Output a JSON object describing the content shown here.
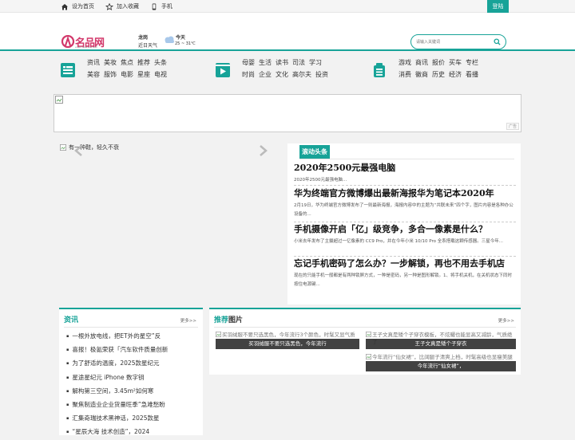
{
  "topbar": {
    "links": [
      {
        "label": "设为首页",
        "icon": "home-icon"
      },
      {
        "label": "加入收藏",
        "icon": "star-icon"
      },
      {
        "label": "手机",
        "icon": "mobile-icon"
      }
    ],
    "register": "注册",
    "login": "登陆"
  },
  "header": {
    "logo_text": "名品网",
    "logo_sub": "www.mpwang.com",
    "city": "龙岗",
    "city_sub": "近日天气",
    "weather_today": "今天",
    "weather_temp": "25 ~ 31℃",
    "search_placeholder": "请输入关键词"
  },
  "nav": {
    "groups": [
      {
        "icon": "list-icon",
        "row1": [
          "资讯",
          "美妆",
          "焦点",
          "推荐",
          "头条"
        ],
        "row2": [
          "美容",
          "服饰",
          "电影",
          "星座",
          "电视"
        ]
      },
      {
        "icon": "video-icon",
        "row1": [
          "母婴",
          "生活",
          "读书",
          "司法",
          "学习"
        ],
        "row2": [
          "时尚",
          "企业",
          "文化",
          "高尔夫",
          "投资"
        ]
      },
      {
        "icon": "files-icon",
        "row1": [
          "游戏",
          "商讯",
          "报价",
          "买车",
          "专栏"
        ],
        "row2": [
          "消费",
          "徽商",
          "历史",
          "经济",
          "看播"
        ]
      }
    ]
  },
  "banner": {
    "ad_label": "广告"
  },
  "slider": {
    "caption": "有一种鞋，轻久不衰"
  },
  "news": {
    "header": "滚动头条",
    "items": [
      {
        "title": "2020年2500元最强电脑",
        "desc": "2020年2500元最强电脑..."
      },
      {
        "title": "华为终端官方微博爆出最新海报华为笔记本2020年",
        "desc": "2月19日，华为终端官方微博发布了一则最新海报，海报内容中的主题为“共联未来”四个字，图片内容是各种办公设备的..."
      },
      {
        "title": "手机摄像开启「亿」级竞争，多合一像素是什么？",
        "desc": "小米去年发布了主摄超过一亿像素的 CC9 Pro，并在今年小米 10/10 Pro 全系搭载这颗传感器。三星今年..."
      },
      {
        "title": "忘记手机密码了怎么办？一步解锁，再也不用去手机店",
        "desc": "现在的只能手机一般都是有两种锁屏方式，一种是密码，另一种是图形解锁。1、将手机关机，在关机状态下同时按住电源键..."
      }
    ]
  },
  "zixun": {
    "title": "资讯",
    "more": "更多>>",
    "items": [
      "一根外放电线，把ET外的星空”反",
      "喜报！极氪荣获「汽车软件质量创新",
      "为了舒适的温度，2025款星纪元",
      "星途星纪元 iPhone 数字钥",
      "解构第三空间，3.45m²如何寒",
      "聚焦制造业企业货量旺季”急难愁盼",
      "汇集奇瑞技术黑神话，2025款星",
      "“星辰大海 技术创造”，2024"
    ]
  },
  "tuijian": {
    "title_a": "推荐",
    "title_b": "图片",
    "more": "更多>>",
    "pics": [
      {
        "alt": "买羽绒服不要只选黑色，今年流行3个颜色，时髦又显气质",
        "caption": "买羽绒服不要只选黑色，今年流行"
      },
      {
        "alt": "王子文真是矮个子穿衣模板，不炫耀也能显高又减龄，气质绝了",
        "caption": "王子文真是矮个子穿衣"
      },
      {
        "alt": "今年流行“仙女裙”，比阔腿子清爽上档，时髦高级也显瘦美腿",
        "caption": "今年流行“仙女裙”，"
      }
    ]
  },
  "colors": {
    "accent": "#17a398",
    "logo": "#d2376a"
  }
}
